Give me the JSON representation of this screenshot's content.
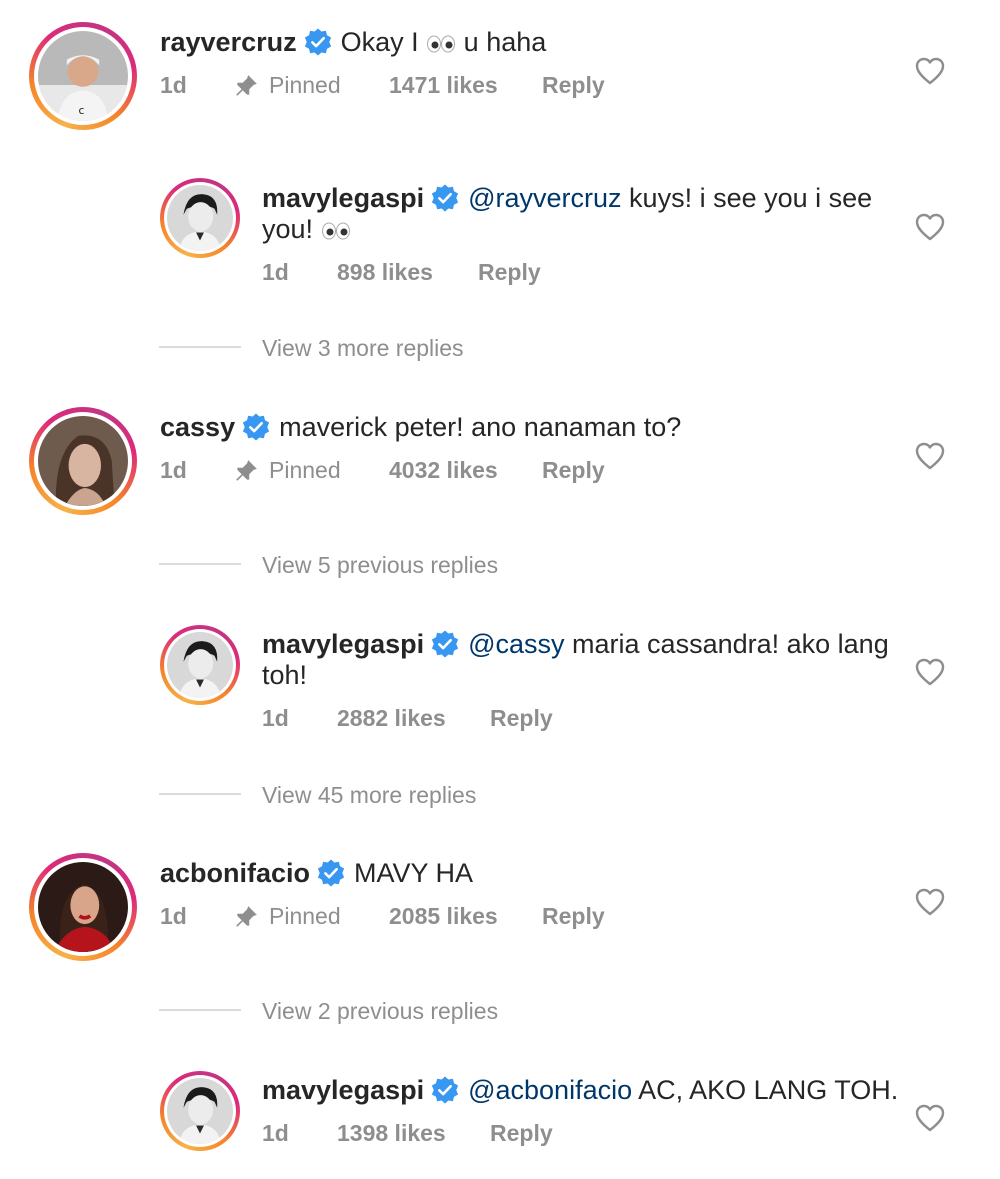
{
  "comments": [
    {
      "username": "rayvercruz",
      "text_before": "Okay I",
      "text_after": "u haha",
      "emoji": "eyes",
      "time": "1d",
      "pinned": "Pinned",
      "likes": "1471 likes",
      "reply": "Reply"
    },
    {
      "username": "mavylegaspi",
      "mention": "@rayvercruz",
      "text_line1": "kuys! i see you i see",
      "text_line2": "you!",
      "emoji": "eyes",
      "time": "1d",
      "likes": "898 likes",
      "reply": "Reply"
    },
    {
      "username": "cassy",
      "text": "maverick peter! ano nanaman to?",
      "time": "1d",
      "pinned": "Pinned",
      "likes": "4032 likes",
      "reply": "Reply"
    },
    {
      "username": "mavylegaspi",
      "mention": "@cassy",
      "text_line1": "maria cassandra! ako lang",
      "text_line2": "toh!",
      "time": "1d",
      "likes": "2882 likes",
      "reply": "Reply"
    },
    {
      "username": "acbonifacio",
      "text": "MAVY HA",
      "time": "1d",
      "pinned": "Pinned",
      "likes": "2085 likes",
      "reply": "Reply"
    },
    {
      "username": "mavylegaspi",
      "mention": "@acbonifacio",
      "text": "AC, AKO LANG TOH.",
      "time": "1d",
      "likes": "1398 likes",
      "reply": "Reply"
    }
  ],
  "view_replies": [
    "View 3 more replies",
    "View 5 previous replies",
    "View 45 more replies",
    "View 2 previous replies"
  ],
  "colors": {
    "verified": "#3897f0",
    "mention": "#00376b",
    "muted": "#8e8e8e",
    "ring_start": "#f58529",
    "ring_end": "#dd2a7b"
  },
  "icons": {
    "verified": "verified-badge-icon",
    "pin": "pin-icon",
    "like": "heart-outline-icon",
    "emoji": "eyes-emoji"
  }
}
